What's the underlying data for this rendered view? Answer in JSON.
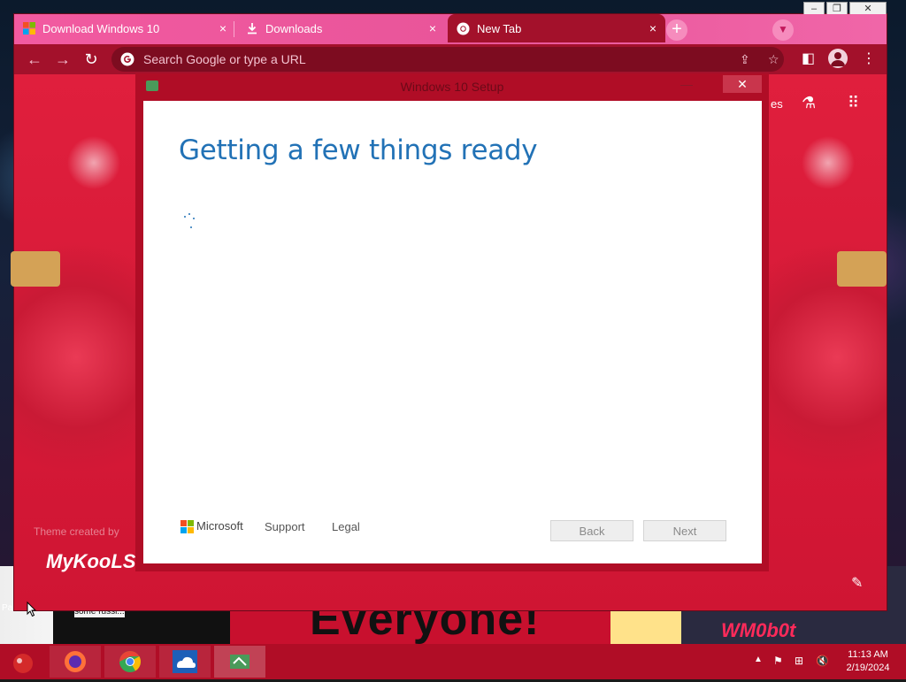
{
  "browser": {
    "tabs": [
      {
        "title": "Download Windows 10",
        "icon": "windows-logo-icon",
        "active": false
      },
      {
        "title": "Downloads",
        "icon": "download-icon",
        "active": false
      },
      {
        "title": "New Tab",
        "icon": "chrome-icon",
        "active": true
      }
    ],
    "tab_close": "×",
    "new_tab": "+",
    "omnibox_placeholder": "Search Google or type a URL",
    "ntp": {
      "partial_text": "es",
      "theme_credit": "Theme created by",
      "theme_brand": "MyKooLS"
    }
  },
  "setup": {
    "window_title": "Windows 10 Setup",
    "heading": "Getting a few things ready",
    "brand": "Microsoft",
    "links": [
      "Support",
      "Legal"
    ],
    "back_label": "Back",
    "next_label": "Next"
  },
  "desktop": {
    "banner_text": "Everyone!",
    "caption": "some russi...",
    "watermark": "WM0b0t",
    "icon_label": "Pa"
  },
  "taskbar": {
    "apps": [
      {
        "name": "firefox-icon"
      },
      {
        "name": "chrome-icon"
      },
      {
        "name": "onedrive-icon"
      },
      {
        "name": "windows-setup-icon"
      }
    ],
    "time": "11:13 AM",
    "date": "2/19/2024"
  },
  "colors": {
    "accent": "#a3112b",
    "tabstrip": "#f25aa0",
    "heading_blue": "#2272b6"
  }
}
